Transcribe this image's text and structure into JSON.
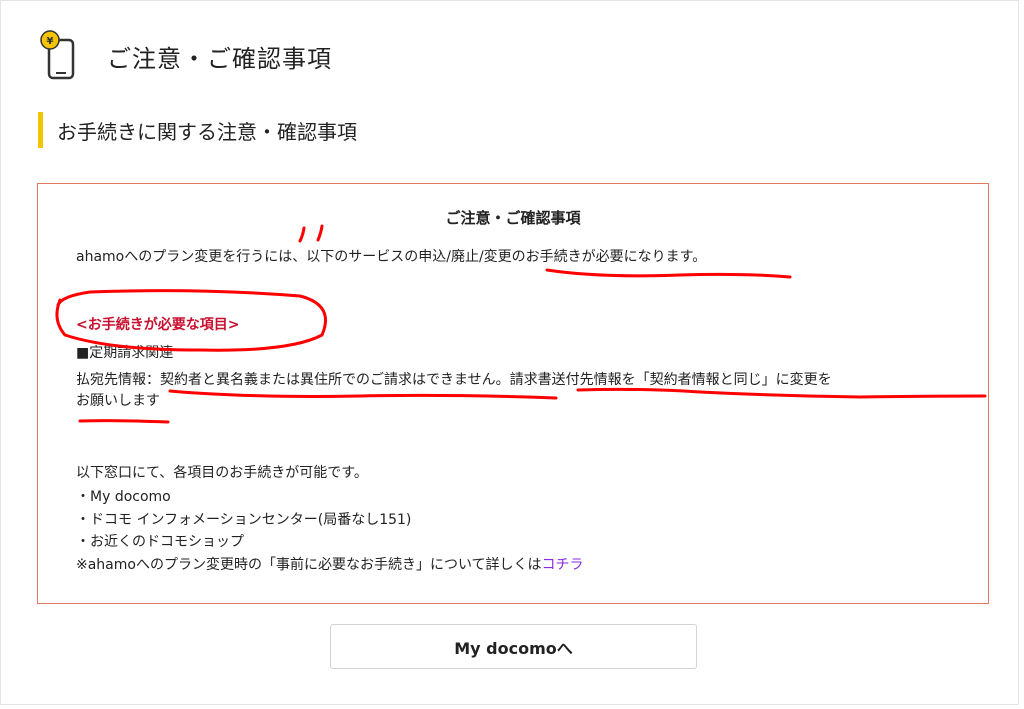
{
  "header": {
    "title": "ご注意・ご確認事項",
    "icon": "yen-phone-icon",
    "icon_symbol": "¥"
  },
  "section": {
    "title": "お手続きに関する注意・確認事項",
    "accent_color": "#f5c400"
  },
  "notice": {
    "heading": "ご注意・ご確認事項",
    "intro": "ahamoへのプラン変更を行うには、以下のサービスの申込/廃止/変更のお手続きが必要になります。",
    "required_label": "<お手続きが必要な項目>",
    "category": "■定期請求関連",
    "payer_line1": "払宛先情報：契約者と異名義または異住所でのご請求はできません。請求書送付先情報を「契約者情報と同じ」に変更を",
    "payer_line2": "お願いします",
    "window_intro": "以下窓口にて、各項目のお手続きが可能です。",
    "windows": [
      "・My docomo",
      "・ドコモ インフォメーションセンター(局番なし151)",
      "・お近くのドコモショップ"
    ],
    "note_prefix": "※ahamoへのプラン変更時の「事前に必要なお手続き」について詳しくは",
    "note_link": "コチラ",
    "border_color": "#e07a5f",
    "required_color": "#c8102e",
    "link_color": "#8a2be2"
  },
  "button": {
    "label": "My docomoへ"
  },
  "annotation_color": "#ff0000"
}
